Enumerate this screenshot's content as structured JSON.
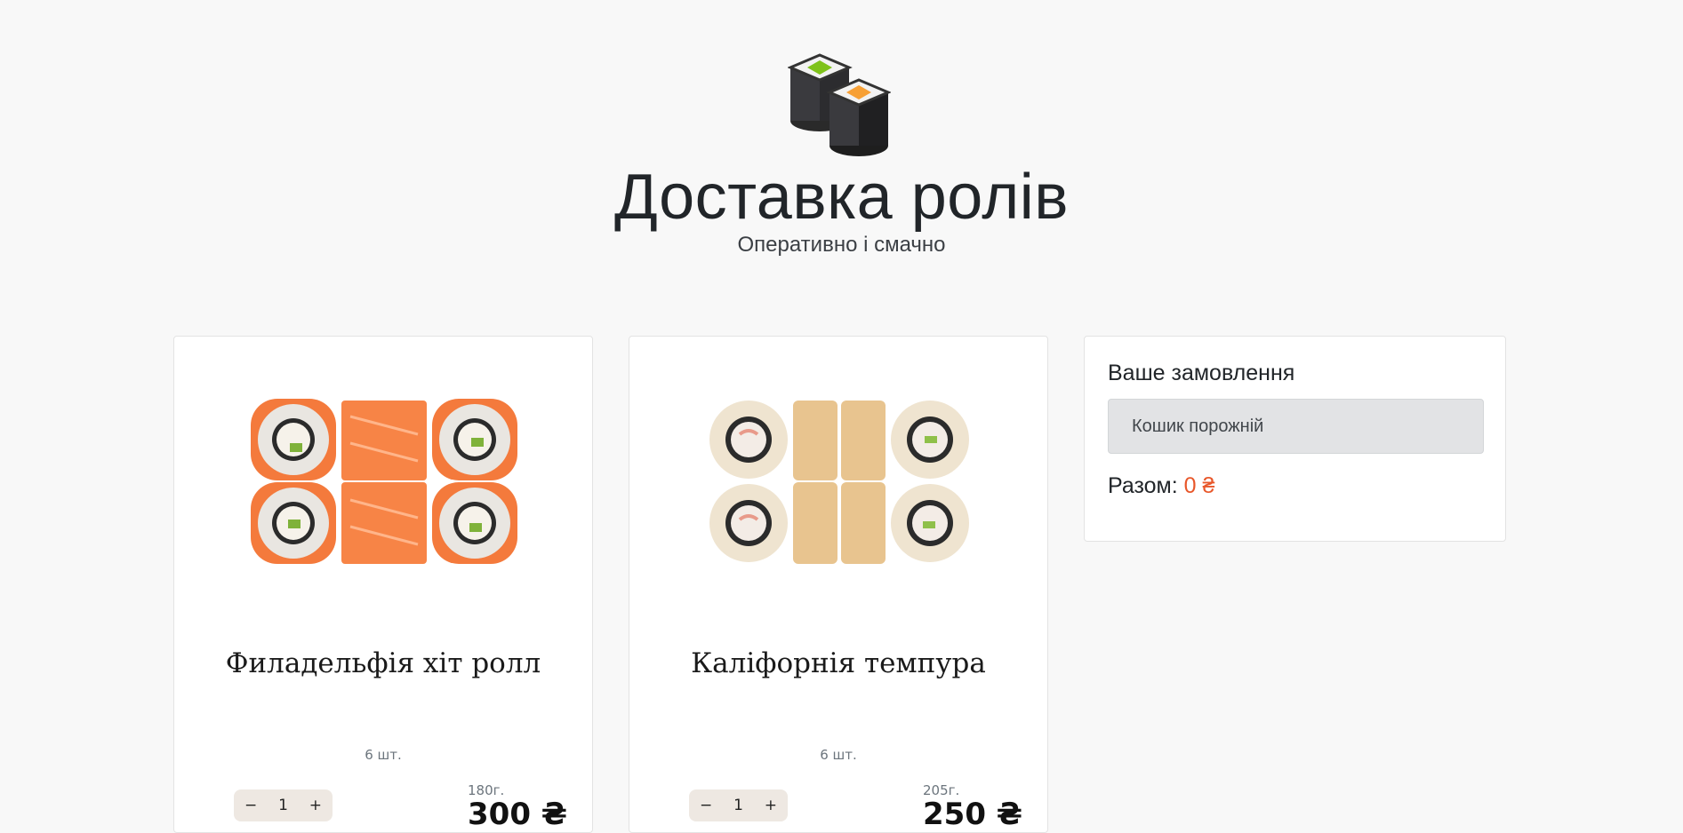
{
  "header": {
    "title": "Доставка ролів",
    "subtitle": "Оперативно і смачно"
  },
  "products": [
    {
      "title": "Филадельфія хіт ролл",
      "pieces": "6 шт.",
      "qty_minus": "−",
      "qty_value": "1",
      "qty_plus": "+",
      "weight": "180г.",
      "price": "300 ₴"
    },
    {
      "title": "Каліфорнія темпура",
      "pieces": "6 шт.",
      "qty_minus": "−",
      "qty_value": "1",
      "qty_plus": "+",
      "weight": "205г.",
      "price": "250 ₴"
    }
  ],
  "cart": {
    "title": "Ваше замовлення",
    "empty_text": "Кошик порожній",
    "total_label": "Разом:",
    "total_value": "0 ₴"
  },
  "colors": {
    "accent": "#e8572a",
    "background": "#f8f8f8"
  }
}
